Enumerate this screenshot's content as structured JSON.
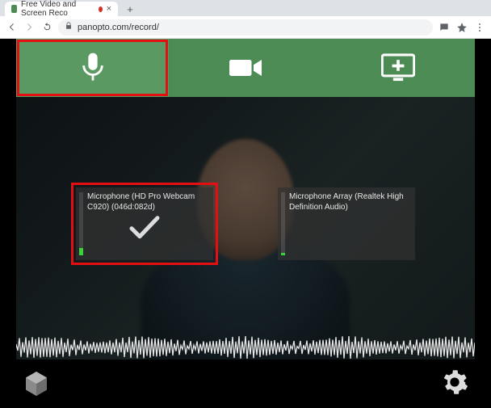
{
  "browser": {
    "tab_title": "Free Video and Screen Reco",
    "url": "panopto.com/record/",
    "recording": true
  },
  "tabs": {
    "labels": [
      "Audio",
      "Video",
      "Screens and Apps"
    ],
    "active": 0
  },
  "devices": [
    {
      "name": "Microphone (HD Pro Webcam C920) (046d:082d)",
      "selected": true,
      "level_pct": 12
    },
    {
      "name": "Microphone Array (Realtek High Definition Audio)",
      "selected": false,
      "level_pct": 4
    }
  ],
  "colors": {
    "accent": "#4d8b55",
    "highlight": "#e30f13",
    "meter": "#3bd23b"
  },
  "controls": {
    "settings_label": "Settings"
  }
}
